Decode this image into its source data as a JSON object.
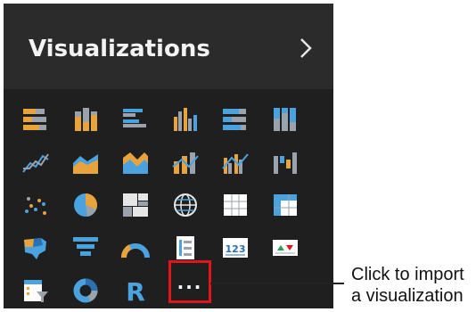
{
  "panel": {
    "title": "Visualizations"
  },
  "icons": [
    "stacked-bar-chart-icon",
    "stacked-column-chart-icon",
    "clustered-bar-chart-icon",
    "clustered-column-chart-icon",
    "100-stacked-bar-chart-icon",
    "100-stacked-column-chart-icon",
    "line-chart-icon",
    "area-chart-icon",
    "stacked-area-chart-icon",
    "line-and-stacked-column-chart-icon",
    "line-and-clustered-column-chart-icon",
    "waterfall-chart-icon",
    "scatter-chart-icon",
    "pie-chart-icon",
    "treemap-icon",
    "map-icon",
    "table-icon",
    "matrix-icon",
    "filled-map-icon",
    "funnel-icon",
    "gauge-icon",
    "multi-row-card-icon",
    "card-icon",
    "kpi-icon",
    "slicer-icon",
    "donut-chart-icon",
    "r-script-visual-icon",
    "import-custom-visual-icon"
  ],
  "more_button": {
    "label": "..."
  },
  "callout": {
    "line1": "Click to import",
    "line2": "a visualization"
  },
  "colors": {
    "panel_bg": "#1f1f1f",
    "header_bg": "#2b2b2b",
    "orange": "#e8a33d",
    "blue": "#4aa3df",
    "dark_blue": "#2b6fb5",
    "highlight_red": "#e0161b"
  }
}
